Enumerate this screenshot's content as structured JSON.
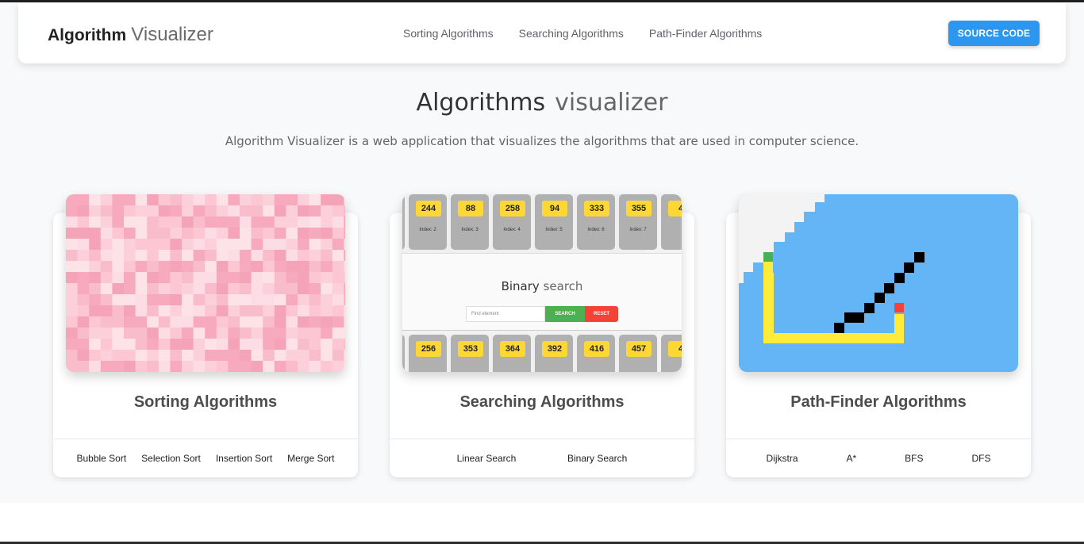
{
  "navbar": {
    "brand_bold": "Algorithm",
    "brand_light": "Visualizer",
    "links": [
      "Sorting Algorithms",
      "Searching Algorithms",
      "Path-Finder Algorithms"
    ],
    "source_button": "SOURCE CODE"
  },
  "hero": {
    "title_main": "Algorithms",
    "title_light": "visualizer",
    "subtitle": "Algorithm Visualizer is a web application that visualizes the algorithms that are used in computer science."
  },
  "cards": [
    {
      "title": "Sorting Algorithms",
      "links": [
        "Bubble Sort",
        "Selection Sort",
        "Insertion Sort",
        "Merge Sort"
      ]
    },
    {
      "title": "Searching Algorithms",
      "links": [
        "Linear Search",
        "Binary Search"
      ]
    },
    {
      "title": "Path-Finder Algorithms",
      "links": [
        "Dijkstra",
        "A*",
        "BFS",
        "DFS"
      ]
    }
  ],
  "search_thumb": {
    "top_values": [
      "244",
      "88",
      "258",
      "94",
      "333",
      "355"
    ],
    "top_indexes": [
      "Index: 2",
      "Index: 3",
      "Index: 4",
      "Index: 5",
      "Index: 6",
      "Index: 7"
    ],
    "bottom_values": [
      "256",
      "353",
      "364",
      "392",
      "416",
      "457"
    ],
    "title_main": "Binary",
    "title_light": "search",
    "input_placeholder": "Find element",
    "search_label": "SEARCH",
    "reset_label": "RESET"
  },
  "colors": {
    "accent": "#2d96ee",
    "sorting_pink": "#f8b4c4",
    "path_blue": "#64b5f6",
    "path_yellow": "#ffeb3b"
  }
}
